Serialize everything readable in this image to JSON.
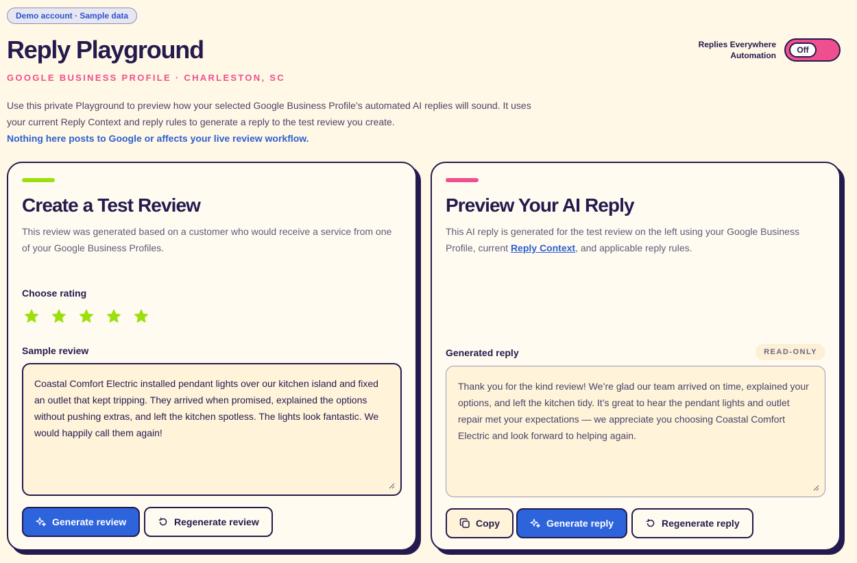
{
  "header": {
    "demo_badge": "Demo account · Sample data",
    "title": "Reply Playground",
    "subtitle": "GOOGLE BUSINESS PROFILE · CHARLESTON, SC",
    "intro": "Use this private Playground to preview how your selected Google Business Profile’s automated AI replies will sound. It uses your current Reply Context and reply rules to generate a reply to the test review you create.",
    "notice": "Nothing here posts to Google or affects your live review workflow."
  },
  "automation": {
    "label_line1": "Replies Everywhere",
    "label_line2": "Automation",
    "toggle_state": "Off"
  },
  "test_review": {
    "title": "Create a Test Review",
    "description": "This review was generated based on a customer who would receive a service from one of your Google Business Profiles.",
    "rating_label": "Choose rating",
    "rating": 5,
    "rating_max": 5,
    "star_color": "#9be00c",
    "sample_label": "Sample review",
    "sample_text": "Coastal Comfort Electric installed pendant lights over our kitchen island and fixed an outlet that kept tripping. They arrived when promised, explained the options without pushing extras, and left the kitchen spotless. The lights look fantastic. We would happily call them again!",
    "generate_button": "Generate review",
    "regenerate_button": "Regenerate review"
  },
  "preview_reply": {
    "title": "Preview Your AI Reply",
    "description_before": "This AI reply is generated for the test review on the left using your Google Business Profile, current ",
    "description_link": "Reply Context",
    "description_after": ", and applicable reply rules.",
    "generated_label": "Generated reply",
    "readonly_badge": "READ-ONLY",
    "reply_text": "Thank you for the kind review! We’re glad our team arrived on time, explained your options, and left the kitchen tidy. It’s great to hear the pendant lights and outlet repair met your expectations — we appreciate you choosing Coastal Comfort Electric and look forward to helping again.",
    "copy_button": "Copy",
    "generate_button": "Generate reply",
    "regenerate_button": "Regenerate reply"
  },
  "colors": {
    "background": "#fff8e6",
    "ink": "#241a4d",
    "accent_pink": "#ef4f8e",
    "accent_green": "#9be00c",
    "primary_blue": "#2d63db"
  }
}
